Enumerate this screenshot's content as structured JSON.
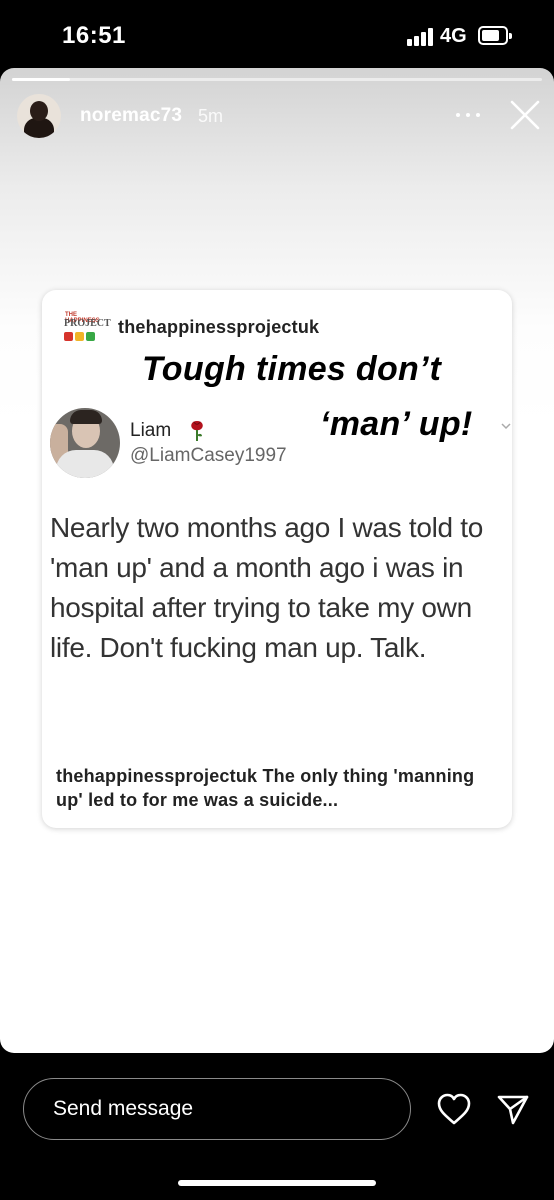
{
  "status_bar": {
    "time": "16:51",
    "network": "4G",
    "icons": [
      "signal-icon",
      "battery-icon"
    ]
  },
  "story": {
    "username": "noremac73",
    "posted_ago": "5m",
    "progress": 0.11,
    "icons": [
      "more-icon",
      "close-icon"
    ]
  },
  "shared_post": {
    "account": "thehappinessprojectuk",
    "logo": {
      "top_text": "THE HAPPINESS",
      "main_text": "PROJECT"
    },
    "headline_line1": "Tough  times don’t",
    "headline_line2": "‘man’ up!",
    "tweet": {
      "name": "Liam",
      "handle": "@LiamCasey1997",
      "text": "Nearly two months ago I was told to 'man up' and a month ago i was in hospital after trying to take my own life. Don't fucking man up. Talk."
    },
    "caption_account": "thehappinessprojectuk",
    "caption_text": " The only thing 'manning up' led to for me was a suicide..."
  },
  "reply_bar": {
    "placeholder": "Send message",
    "icons": [
      "heart-icon",
      "send-icon"
    ]
  },
  "colors": {
    "background": "#000000",
    "card": "#ffffff",
    "rose": "#b3121d"
  }
}
